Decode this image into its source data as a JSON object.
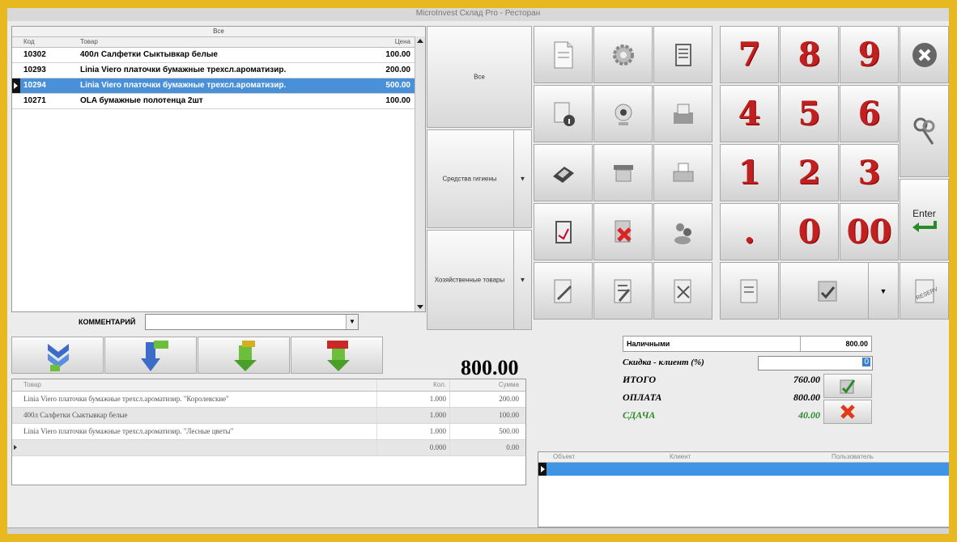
{
  "window": {
    "title": "MicroInvest Склад Pro - Ресторан"
  },
  "products": {
    "group_header": "Все",
    "columns": [
      "Код",
      "Товар",
      "Цена"
    ],
    "rows": [
      {
        "code": "10302",
        "name": "400л Салфетки Сыктывкар белые",
        "price": "100.00"
      },
      {
        "code": "10293",
        "name": "Linia Viero платочки бумажные трехсл.ароматизир.",
        "price": "200.00"
      },
      {
        "code": "10294",
        "name": "Linia Viero платочки бумажные трехсл.ароматизир.",
        "price": "500.00"
      },
      {
        "code": "10271",
        "name": "OLA бумажные полотенца 2шт",
        "price": "100.00"
      }
    ]
  },
  "comment": {
    "label": "КОММЕНТАРИЙ",
    "value": ""
  },
  "categories": [
    {
      "label": "Все"
    },
    {
      "label": "Средства гигиены"
    },
    {
      "label": "Хозяйственные товары"
    }
  ],
  "order_buttons": [
    {
      "icon": "collapse-arrows-icon"
    },
    {
      "icon": "sort-numeric-desc-icon"
    },
    {
      "icon": "sort-alpha-icon"
    },
    {
      "icon": "sort-amount-icon"
    }
  ],
  "total": "800.00",
  "order": {
    "columns": [
      "Товар",
      "Кол.",
      "Сумма"
    ],
    "rows": [
      {
        "name": "Linia Viero платочки бумажные трехсл.ароматизир. \"Королевские\"",
        "qty": "1.000",
        "sum": "200.00"
      },
      {
        "name": "400л Салфетки Сыктывкар белые",
        "qty": "1.000",
        "sum": "100.00"
      },
      {
        "name": "Linia Viero платочки бумажные трехсл.ароматизир. \"Лесные цветы\"",
        "qty": "1.000",
        "sum": "500.00"
      },
      {
        "name": "",
        "qty": "0.000",
        "sum": "0.00"
      }
    ]
  },
  "keypad": {
    "digits": [
      "7",
      "8",
      "9",
      "4",
      "5",
      "6",
      "1",
      "2",
      "3",
      ".",
      "0",
      "00"
    ],
    "enter_label": "Enter"
  },
  "payment": {
    "method_label": "Наличными",
    "method_value": "800.00",
    "discount_label": "Скидка - клиент (%)",
    "discount_value": "0",
    "total_label": "ИТОГО",
    "total_value": "760.00",
    "paid_label": "ОПЛАТА",
    "paid_value": "800.00",
    "change_label": "СДАЧА",
    "change_value": "40.00",
    "change_color": "#2a8a2a"
  },
  "clients": {
    "columns": [
      "Объект",
      "Клиент",
      "Пользователь"
    ]
  },
  "colors": {
    "accent_blue": "#4a90d9",
    "digit_red": "#c02020",
    "frame": "#e8b820"
  }
}
